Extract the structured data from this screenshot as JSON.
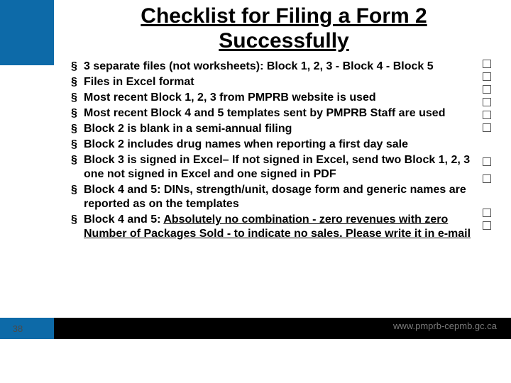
{
  "slide": {
    "title": "Checklist for Filing a Form 2 Successfully",
    "page_number": "38",
    "footer_url": "www.pmprb-cepmb.gc.ca"
  },
  "bullets": [
    {
      "text": "3 separate files (not worksheets): Block 1, 2, 3 - Block 4 - Block 5"
    },
    {
      "text": "Files in Excel format"
    },
    {
      "text": "Most recent Block 1, 2, 3 from PMPRB website is used"
    },
    {
      "text": "Most recent Block 4 and 5 templates sent by PMPRB Staff are used"
    },
    {
      "text": "Block 2 is blank in a semi-annual filing"
    },
    {
      "text": "Block 2 includes drug names when reporting a first day sale"
    },
    {
      "text": "Block 3 is signed in Excel– If not signed in Excel, send two Block 1, 2, 3 one not signed in Excel and one signed in PDF"
    },
    {
      "text": "Block 4 and 5: DINs, strength/unit, dosage form and generic names are reported as on the templates"
    },
    {
      "text_prefix": "Block 4 and 5: ",
      "text_underlined": "Absolutely no combination - zero revenues with zero Number of Packages Sold - to indicate no sales.  Please write it in e-mail"
    }
  ]
}
